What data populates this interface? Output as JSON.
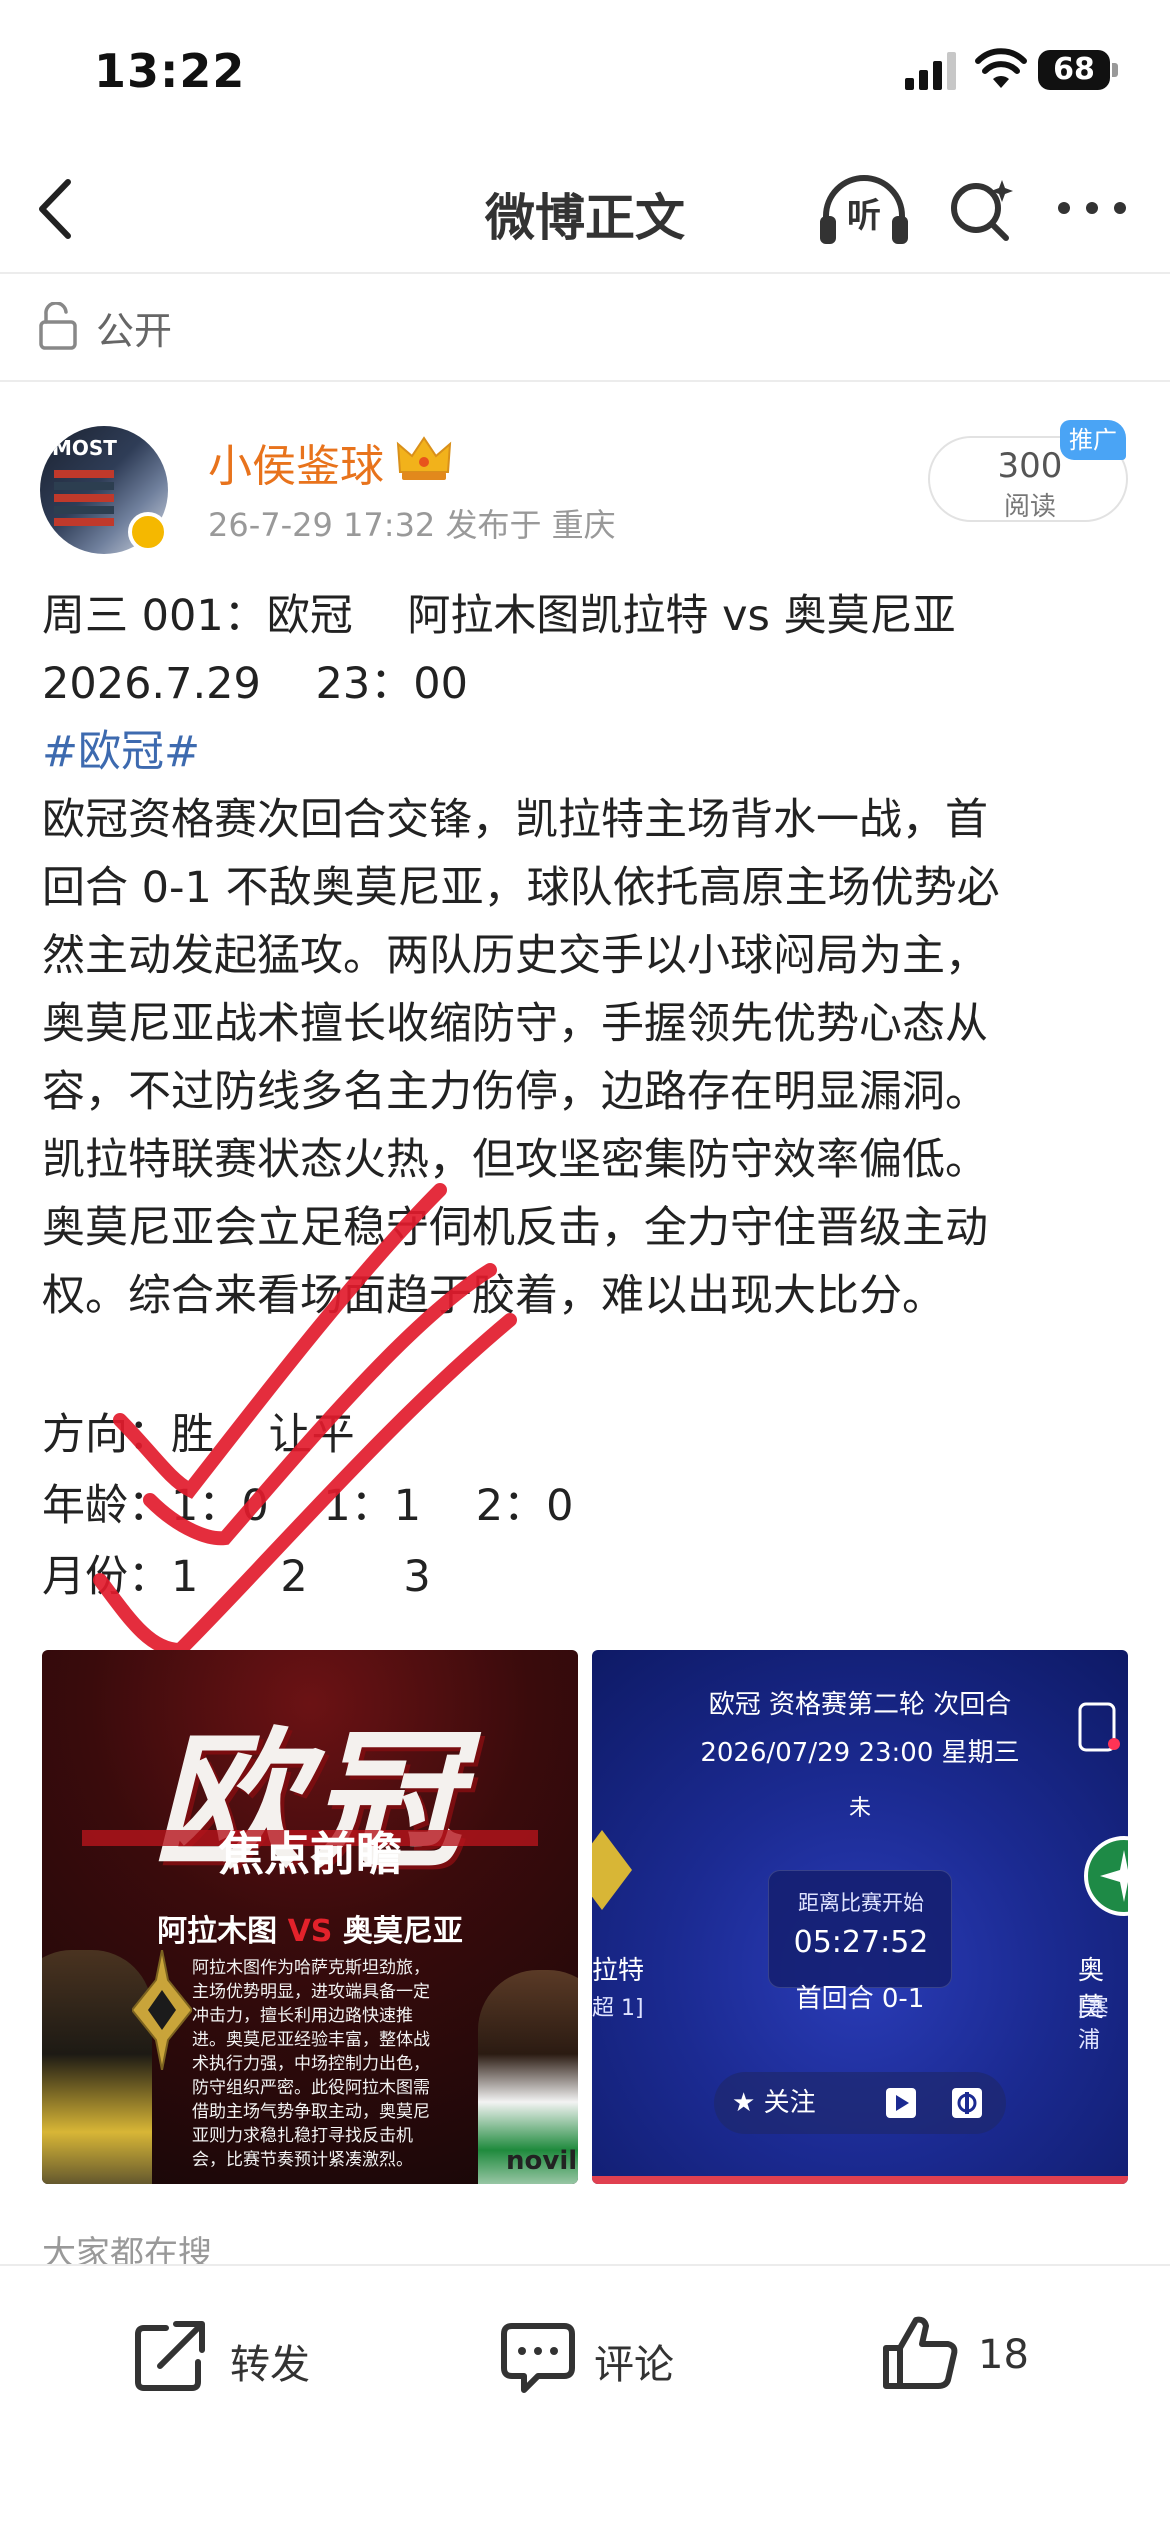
{
  "status_bar": {
    "time": "13:22",
    "battery": "68"
  },
  "nav": {
    "title": "微博正文",
    "listen_label": "听"
  },
  "visibility": {
    "label": "公开"
  },
  "post": {
    "username": "小侯鉴球",
    "meta": "26-7-29 17:32  发布于 重庆",
    "read_count": "300",
    "read_label": "阅读",
    "promo_badge": "推广",
    "avatar_text": "MOST",
    "content_lines": [
      "周三 001：欧冠    阿拉木图凯拉特 vs 奥莫尼亚",
      "2026.7.29    23：00",
      "#欧冠#",
      "欧冠资格赛次回合交锋，凯拉特主场背水一战，首",
      "回合 0-1 不敌奥莫尼亚，球队依托高原主场优势必",
      "然主动发起猛攻。两队历史交手以小球闷局为主，",
      "奥莫尼亚战术擅长收缩防守，手握领先优势心态从",
      "容，不过防线多名主力伤停，边路存在明显漏洞。",
      "凯拉特联赛状态火热，但攻坚密集防守效率偏低。",
      "奥莫尼亚会立足稳守伺机反击，全力守住晋级主动",
      "权。综合来看场面趋于胶着，难以出现大比分。"
    ],
    "picks": [
      "方向：胜    让平",
      "年龄：1：0    1：1    2：0",
      "月份：1      2       3"
    ]
  },
  "image_left": {
    "title": "欧冠",
    "subtitle": "焦点前瞻",
    "team_home": "阿拉木图",
    "vs": "VS",
    "team_away": "奥莫尼亚",
    "preview": "阿拉木图作为哈萨克斯坦劲旅，主场优势明显，进攻端具备一定冲击力，擅长利用边路快速推进。奥莫尼亚经验丰富，整体战术执行力强，中场控制力出色，防守组织严密。此役阿拉木图需借助主场气势争取主动，奥莫尼亚则力求稳扎稳打寻找反击机会，比赛节奏预计紧凑激烈。",
    "sponsor": "novil"
  },
  "image_right": {
    "stage": "欧冠 资格赛第二轮 次回合",
    "datetime": "2026/07/29 23:00  星期三",
    "status": "未",
    "countdown_label": "距离比赛开始",
    "countdown_time": "05:27:52",
    "first_leg": "首回合 0-1",
    "team_left_name": "拉特",
    "team_left_sub": "超 1]",
    "team_right_name": "奥莫",
    "team_right_sub": "[塞浦",
    "follow_label": "关注"
  },
  "everyone_search": "大家都在搜",
  "bottom_bar": {
    "repost_label": "转发",
    "comment_label": "评论",
    "like_count": "18"
  },
  "colors": {
    "username": "#e8731c",
    "hashtag": "#3d6aaf",
    "checkmark": "#e21b2c",
    "promo_badge": "#4aa4f5"
  }
}
